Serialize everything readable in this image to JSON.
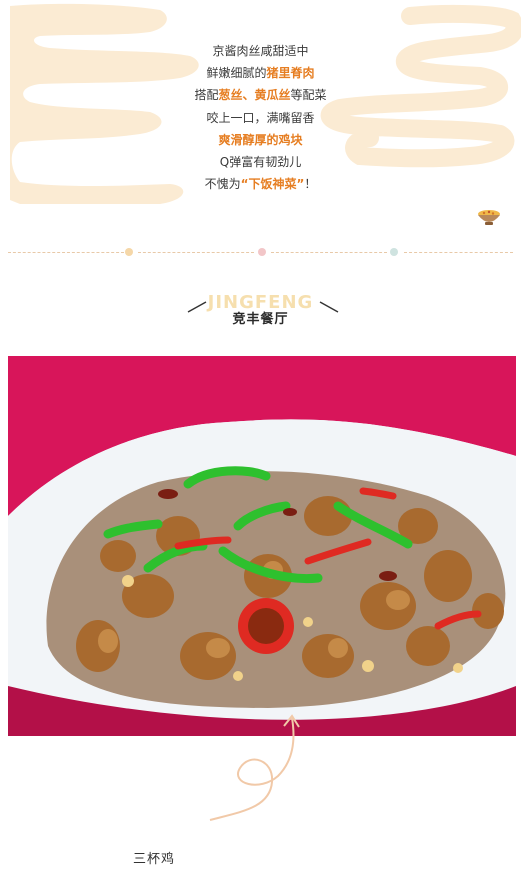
{
  "poem": {
    "line1": "京酱肉丝咸甜适中",
    "line2_pre": "鲜嫩细腻的",
    "line2_hl": "猪里脊肉",
    "line3_pre": "搭配",
    "line3_hl": "葱丝、黄瓜丝",
    "line3_post": "等配菜",
    "line4": "咬上一口，满嘴留香",
    "line5_hl": "爽滑醇厚的鸡块",
    "line6": "Q弹富有韧劲儿",
    "line7_pre": "不愧为",
    "line7_hl": "“下饭神菜”",
    "line7_post": "！"
  },
  "brand": {
    "english": "JINGFENG",
    "chinese": "竞丰餐厅"
  },
  "dish": {
    "name": "三杯鸡"
  },
  "colors": {
    "highlight": "#e67e22",
    "brush": "#fbebd3",
    "photo_background": "#d8155a",
    "dot_colors": [
      "#f5d7a8",
      "#f2c6c8",
      "#cfe3e0"
    ]
  },
  "icons": {
    "bowl": "rice-bowl-icon",
    "arrow": "curly-arrow-icon"
  }
}
